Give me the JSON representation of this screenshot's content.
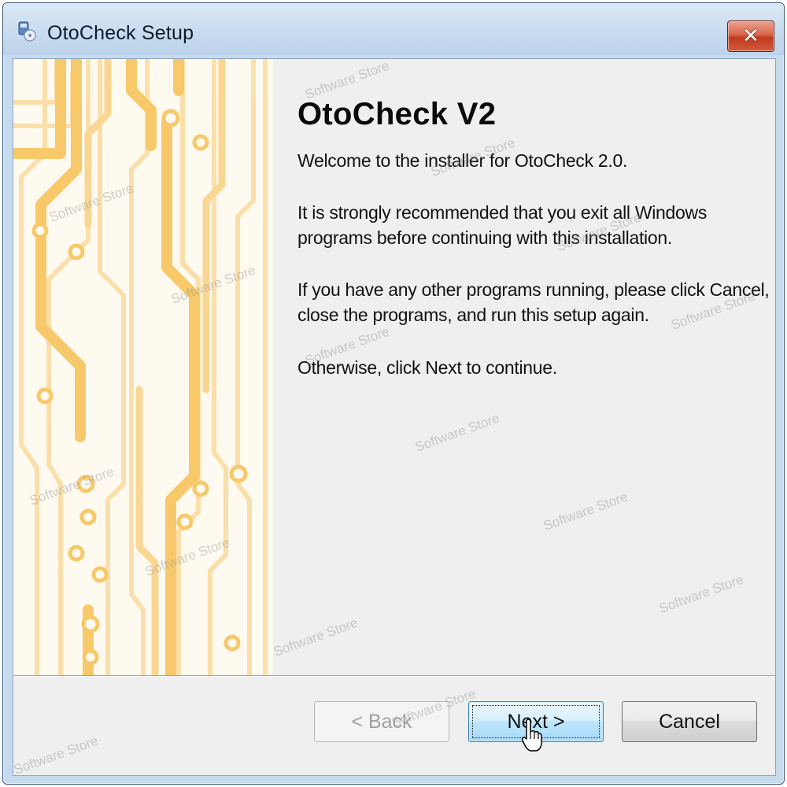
{
  "window": {
    "title": "OtoCheck Setup",
    "close_glyph": "✕",
    "icon": "setup-installer-icon"
  },
  "content": {
    "heading": "OtoCheck V2",
    "paragraphs": [
      "Welcome to the installer for OtoCheck 2.0.",
      "It is strongly recommended that you exit all Windows programs before continuing with this installation.",
      "If you have any other programs running, please click Cancel, close the programs, and run this setup again.",
      "Otherwise, click Next to continue."
    ]
  },
  "buttons": {
    "back_label": "< Back",
    "next_label": "Next >",
    "cancel_label": "Cancel"
  },
  "watermark": "Software Store",
  "colors": {
    "circuit": "#f7c96a",
    "circuit_light": "#fde3a8",
    "close_red": "#c94a2e",
    "next_blue": "#bee6fd"
  }
}
